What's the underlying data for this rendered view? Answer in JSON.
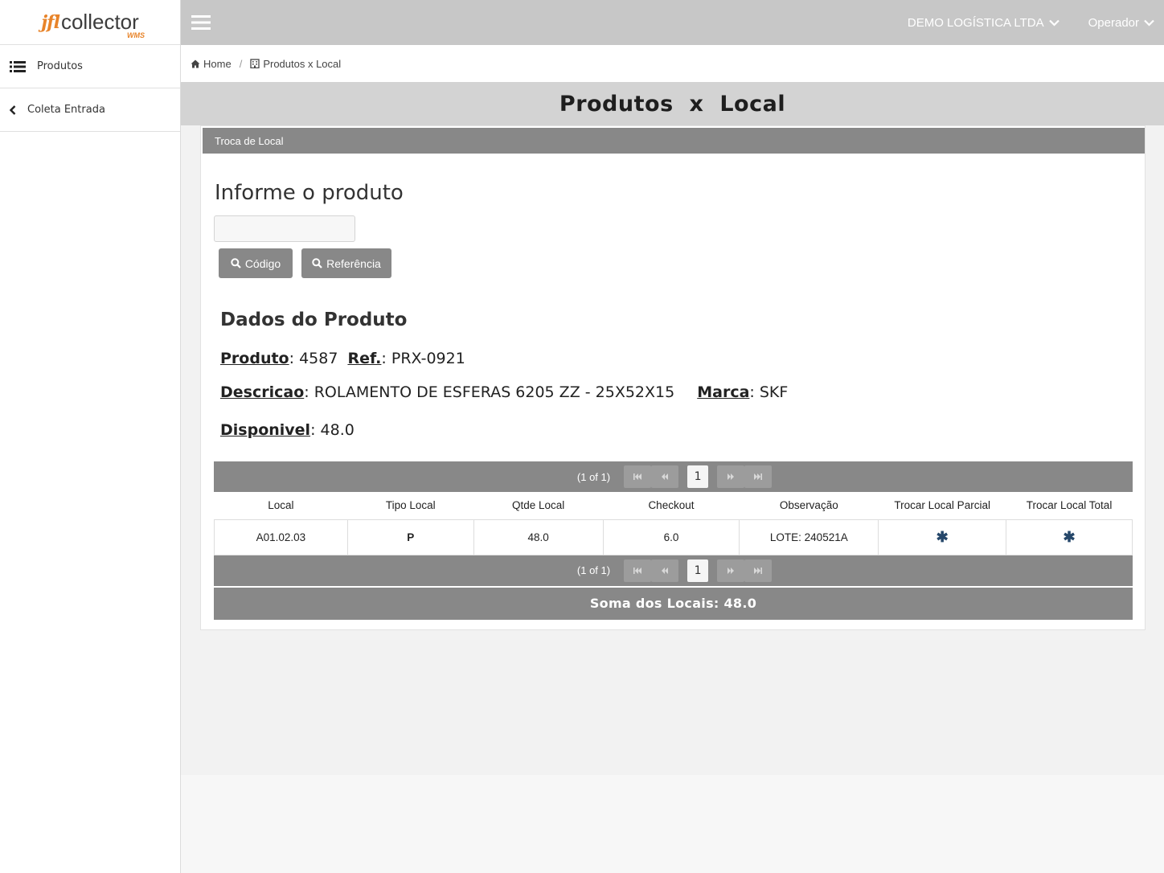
{
  "logo": {
    "mark": "jfl",
    "text": "collector",
    "sub": "WMS"
  },
  "sidebar": {
    "items": [
      {
        "label": "Produtos",
        "icon": "list-icon"
      },
      {
        "label": "Coleta Entrada",
        "icon": "chevron-left-icon"
      }
    ]
  },
  "topbar": {
    "company": "DEMO LOGÍSTICA LTDA",
    "user": "Operador"
  },
  "breadcrumb": {
    "home": "Home",
    "separator": "/",
    "current": "Produtos x Local"
  },
  "page_title": "Produtos x Local",
  "panel": {
    "header": "Troca de Local",
    "prompt": "Informe o produto",
    "input_value": "",
    "btn_codigo": "Código",
    "btn_referencia": "Referência"
  },
  "produto": {
    "section_title": "Dados do Produto",
    "produto_label": "Produto",
    "produto_value": "4587",
    "ref_label": "Ref.",
    "ref_value": "PRX-0921",
    "descricao_label": "Descricao",
    "descricao_value": "ROLAMENTO DE ESFERAS 6205 ZZ - 25X52X15",
    "marca_label": "Marca",
    "marca_value": "SKF",
    "disponivel_label": "Disponivel",
    "disponivel_value": "48.0"
  },
  "table": {
    "pager_status": "(1 of 1)",
    "current_page": "1",
    "columns": [
      "Local",
      "Tipo Local",
      "Qtde Local",
      "Checkout",
      "Observação",
      "Trocar Local Parcial",
      "Trocar Local Total"
    ],
    "rows": [
      {
        "local": "A01.02.03",
        "tipo": "P",
        "qtde": "48.0",
        "checkout": "6.0",
        "obs": "LOTE: 240521A",
        "parcial": "✱",
        "total": "✱"
      }
    ],
    "soma": "Soma dos Locais: 48.0"
  }
}
